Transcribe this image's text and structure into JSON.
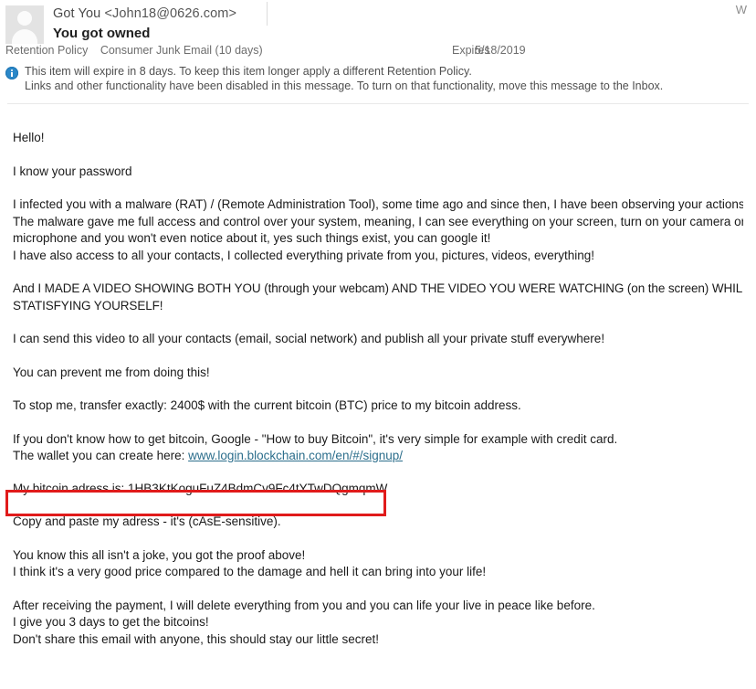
{
  "header": {
    "sender_name": "Got You",
    "sender_email": "<John18@0626.com>",
    "subject": "You got owned",
    "corner_glyph": "W",
    "avatar_icon": "person-avatar-icon",
    "retention": {
      "label": "Retention Policy",
      "value": "Consumer Junk Email (10 days)",
      "expires_label": "Expires",
      "expires_value": "5/18/2019"
    },
    "info": {
      "icon": "info-icon",
      "line1": "This item will expire in 8 days. To keep this item longer apply a different Retention Policy.",
      "line2": "Links and other functionality have been disabled in this message. To turn on that functionality, move this message to the Inbox."
    }
  },
  "body": {
    "paragraphs": [
      {
        "id": "greeting",
        "caps": false,
        "lines": [
          "Hello!"
        ]
      },
      {
        "id": "password-claim",
        "caps": false,
        "lines": [
          "I know your password"
        ]
      },
      {
        "id": "infection-claim",
        "caps": false,
        "lines": [
          "I infected you with a malware (RAT) / (Remote Administration Tool), some time ago and since then, I have been observing your actions.",
          "The malware gave me full access and control over your system, meaning, I can see everything on your screen, turn on your camera or",
          "microphone and you won't even notice about it, yes such things exist, you can google it!",
          "I have also access to all your contacts, I collected everything private from you, pictures, videos, everything!"
        ]
      },
      {
        "id": "video-claim",
        "caps": true,
        "lines": [
          "And I MADE A VIDEO SHOWING BOTH YOU (through your webcam) AND THE VIDEO YOU WERE WATCHING (on the screen) WHILE",
          "STATISFYING YOURSELF!"
        ]
      },
      {
        "id": "distribution-threat",
        "caps": false,
        "lines": [
          "I can send this video to all your contacts (email, social network) and publish all your private stuff everywhere!"
        ]
      },
      {
        "id": "prevent-line",
        "caps": false,
        "lines": [
          "You can prevent me from doing this!"
        ]
      },
      {
        "id": "ransom-demand",
        "caps": false,
        "lines": [
          "To stop me, transfer exactly: 2400$ with the current bitcoin (BTC) price to my bitcoin address."
        ]
      }
    ],
    "howto": {
      "line1": "If you don't know how to get bitcoin, Google - \"How to buy Bitcoin\", it's very simple for example with credit card.",
      "line2_prefix": "The wallet you can create here: ",
      "link_text": "www.login.blockchain.com/en/#/signup/"
    },
    "bitcoin": {
      "prefix": "My bitcoin adress is: ",
      "address": "1HB3KtKoguFuZ4BdmCv9Fc4tYTwDQgmqmW",
      "highlight_color": "#e01b1b"
    },
    "trailing_paragraphs": [
      {
        "id": "case-sensitive-note",
        "lines": [
          "Copy and paste my adress - it's (cAsE-sensitive)."
        ]
      },
      {
        "id": "proof-note",
        "lines": [
          "You know this all isn't a joke, you got the proof above!",
          "I think it's a very good price compared to the damage and hell it can bring into your life!"
        ]
      },
      {
        "id": "closing-note",
        "lines": [
          "After receiving the payment, I will delete everything from you and you can life your live in peace like before.",
          "I give you 3 days to get the bitcoins!",
          "Don't share this email with anyone, this should stay our little secret!"
        ]
      }
    ]
  }
}
